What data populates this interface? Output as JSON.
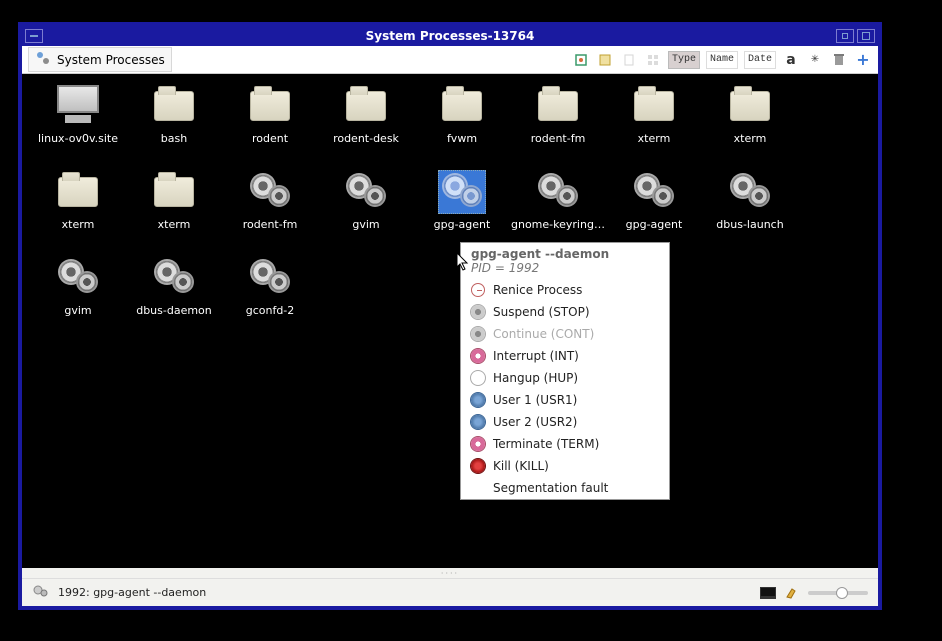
{
  "window": {
    "title": "System Processes-13764"
  },
  "breadcrumb": {
    "label": "System Processes"
  },
  "toolbar": {
    "tag_type": "Type",
    "tag_name": "Name",
    "tag_date": "Date"
  },
  "items": [
    {
      "label": "linux-ov0v.site",
      "icon": "monitor"
    },
    {
      "label": "bash",
      "icon": "folder"
    },
    {
      "label": "rodent",
      "icon": "folder"
    },
    {
      "label": "rodent-desk",
      "icon": "folder"
    },
    {
      "label": "fvwm",
      "icon": "folder"
    },
    {
      "label": "rodent-fm",
      "icon": "folder"
    },
    {
      "label": "xterm",
      "icon": "folder"
    },
    {
      "label": "xterm",
      "icon": "folder"
    },
    {
      "label": "xterm",
      "icon": "folder"
    },
    {
      "label": "xterm",
      "icon": "folder"
    },
    {
      "label": "rodent-fm",
      "icon": "gears"
    },
    {
      "label": "gvim",
      "icon": "gears"
    },
    {
      "label": "gpg-agent",
      "icon": "gears-light",
      "selected": true
    },
    {
      "label": "gnome-keyring-daemon",
      "icon": "gears"
    },
    {
      "label": "gpg-agent",
      "icon": "gears"
    },
    {
      "label": "dbus-launch",
      "icon": "gears"
    },
    {
      "label": "gvim",
      "icon": "gears"
    },
    {
      "label": "dbus-daemon",
      "icon": "gears"
    },
    {
      "label": "gconfd-2",
      "icon": "gears"
    }
  ],
  "context_menu": {
    "command": "gpg-agent --daemon",
    "pid_label": "PID = 1992",
    "items": [
      {
        "label": "Renice Process",
        "icon": "clock"
      },
      {
        "label": "Suspend (STOP)",
        "icon": "gear"
      },
      {
        "label": "Continue (CONT)",
        "icon": "gear",
        "disabled": true
      },
      {
        "label": "Interrupt (INT)",
        "icon": "pink"
      },
      {
        "label": "Hangup (HUP)",
        "icon": "white"
      },
      {
        "label": "User 1 (USR1)",
        "icon": "blue"
      },
      {
        "label": "User 2 (USR2)",
        "icon": "blue"
      },
      {
        "label": "Terminate (TERM)",
        "icon": "pink"
      },
      {
        "label": "Kill (KILL)",
        "icon": "red"
      },
      {
        "label": "Segmentation fault",
        "icon": "none"
      }
    ]
  },
  "statusbar": {
    "text": "1992: gpg-agent --daemon"
  }
}
